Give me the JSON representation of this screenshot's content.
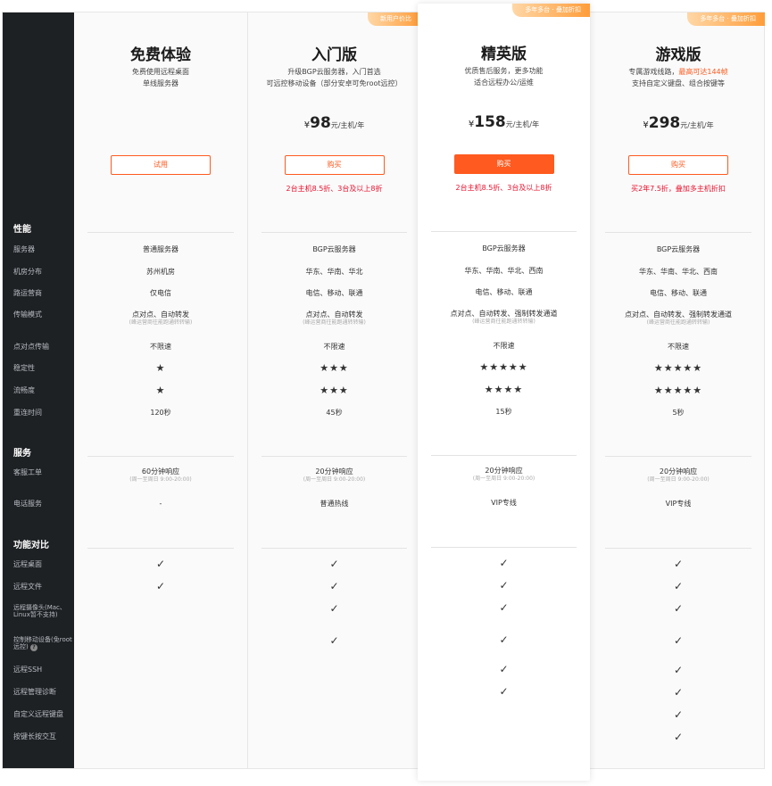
{
  "sidebar": {
    "sections": {
      "performance": "性能",
      "service": "服务",
      "features": "功能对比"
    },
    "rows": {
      "server": "服务器",
      "datacenter": "机房分布",
      "carrier": "路运营商",
      "transfer": "传输模式",
      "p2p": "点对点传输",
      "stability": "稳定性",
      "smoothness": "流畅度",
      "reconnect": "重连时间",
      "ticket": "客服工单",
      "phone": "电话服务",
      "remote_desktop": "远程桌面",
      "remote_file": "远程文件",
      "remote_camera": "远程摄像头(Mac、Linux暂不支持)",
      "mobile_control": "控制移动设备(免root远控)",
      "ssh": "远程SSH",
      "diag": "远程管理诊断",
      "custom_kb": "自定义远程键盘",
      "longpress": "按键长按交互"
    }
  },
  "plans": [
    {
      "name": "免费体验",
      "desc1": "免费使用远程桌面",
      "desc2": "单线服务器",
      "button": "试用",
      "server": "普通服务器",
      "datacenter": "苏州机房",
      "carrier": "仅电信",
      "transfer": "点对点、自动转发",
      "transfer_note": "(峰运营商往能跑通转转输)",
      "p2p": "不限速",
      "stability": "★",
      "smoothness": "★",
      "reconnect": "120秒",
      "ticket": "60分钟响应",
      "ticket_note": "(周一至周日 9:00-20:00)",
      "phone": "-",
      "features": [
        true,
        true,
        false,
        false,
        false,
        false,
        false,
        false
      ]
    },
    {
      "badge": "新用户价比",
      "name": "入门版",
      "desc1": "升级BGP云服务器，入门首选",
      "desc2": "可远控移动设备（部分安卓可免root远控）",
      "currency": "¥",
      "price": "98",
      "unit": "元/主机/年",
      "button": "购买",
      "promo": "2台主机8.5折、3台及以上8折",
      "server": "BGP云服务器",
      "datacenter": "华东、华南、华北",
      "carrier": "电信、移动、联通",
      "transfer": "点对点、自动转发",
      "transfer_note": "(峰运营商往能跑通转转输)",
      "p2p": "不限速",
      "stability": "★★★",
      "smoothness": "★★★",
      "reconnect": "45秒",
      "ticket": "20分钟响应",
      "ticket_note": "(周一至周日 9:00-20:00)",
      "phone": "普通热线",
      "features": [
        true,
        true,
        true,
        true,
        false,
        false,
        false,
        false
      ]
    },
    {
      "badge": "多年多台 · 叠加折扣",
      "name": "精英版",
      "desc1": "优质售后服务，更多功能",
      "desc2": "适合远程办公/运维",
      "currency": "¥",
      "price": "158",
      "unit": "元/主机/年",
      "button": "购买",
      "promo": "2台主机8.5折、3台及以上8折",
      "server": "BGP云服务器",
      "datacenter": "华东、华南、华北、西南",
      "carrier": "电信、移动、联通",
      "transfer": "点对点、自动转发、强制转发通道",
      "transfer_note": "(峰运营商往能跑通转转输)",
      "p2p": "不限速",
      "stability": "★★★★★",
      "smoothness": "★★★★",
      "reconnect": "15秒",
      "ticket": "20分钟响应",
      "ticket_note": "(周一至周日 9:00-20:00)",
      "phone": "VIP专线",
      "features": [
        true,
        true,
        true,
        true,
        true,
        true,
        false,
        false
      ]
    },
    {
      "badge": "多年多台 · 叠加折扣",
      "name": "游戏版",
      "desc1_pre": "专属游戏线路，",
      "desc1_hl": "最高可达144帧",
      "desc2": "支持自定义键盘、组合按键等",
      "currency": "¥",
      "price": "298",
      "unit": "元/主机/年",
      "button": "购买",
      "promo": "买2年7.5折，叠加多主机折扣",
      "server": "BGP云服务器",
      "datacenter": "华东、华南、华北、西南",
      "carrier": "电信、移动、联通",
      "transfer": "点对点、自动转发、强制转发通道",
      "transfer_note": "(峰运营商往能跑通转转输)",
      "p2p": "不限速",
      "stability": "★★★★★",
      "smoothness": "★★★★★",
      "reconnect": "5秒",
      "ticket": "20分钟响应",
      "ticket_note": "(周一至周日 9:00-20:00)",
      "phone": "VIP专线",
      "features": [
        true,
        true,
        true,
        true,
        true,
        true,
        true,
        true
      ]
    }
  ],
  "check_glyph": "✓",
  "colors": {
    "accent": "#ff5a1f",
    "promo": "#e8112d",
    "sidebar": "#1e2124"
  }
}
